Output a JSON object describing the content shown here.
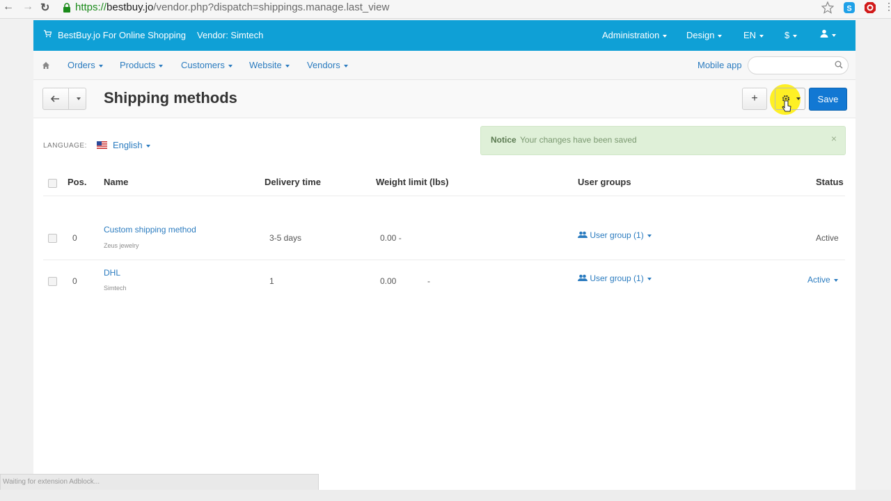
{
  "browser": {
    "url_protocol": "https://",
    "url_host": "bestbuy.jo",
    "url_path": "/vendor.php?dispatch=shippings.manage.last_view",
    "status_text": "Waiting for extension Adblock..."
  },
  "topbar": {
    "store_name": "BestBuy.jo For Online Shopping",
    "vendor": "Vendor: Simtech",
    "menu": [
      "Administration",
      "Design",
      "EN",
      "$"
    ]
  },
  "subnav": {
    "items": [
      "Orders",
      "Products",
      "Customers",
      "Website",
      "Vendors"
    ],
    "mobile_app": "Mobile app",
    "search_placeholder": ""
  },
  "toolbar": {
    "title": "Shipping methods",
    "add_label": "+",
    "save_label": "Save"
  },
  "language": {
    "label": "LANGUAGE:",
    "value": "English"
  },
  "notice": {
    "label": "Notice",
    "text": "Your changes have been saved",
    "close": "×"
  },
  "table": {
    "headers": {
      "pos": "Pos.",
      "name": "Name",
      "delivery": "Delivery time",
      "weight": "Weight limit (lbs)",
      "user_groups": "User groups",
      "status": "Status"
    },
    "rows": [
      {
        "pos": "0",
        "name": "Custom shipping method",
        "sub": "Zeus jewelry",
        "delivery": "3-5 days",
        "weight": "0.00 -",
        "weight_dash": "",
        "user_groups": "User group (1)",
        "status": "Active"
      },
      {
        "pos": "0",
        "name": "DHL",
        "sub": "Simtech",
        "delivery": "1",
        "weight": "0.00",
        "weight_dash": "-",
        "user_groups": "User group (1)",
        "status": "Active"
      }
    ]
  },
  "colors": {
    "topbar": "#0fa0d6",
    "link": "#2a7bbf",
    "save": "#1278d3",
    "notice_bg": "#dff0d8"
  }
}
